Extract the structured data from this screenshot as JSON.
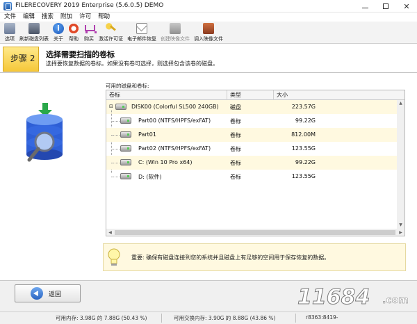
{
  "window": {
    "title": "FILERECOVERY 2019 Enterprise (5.6.0.5) DEMO",
    "minimize_glyph": "—",
    "maximize_glyph": "☐",
    "close_glyph": "✕"
  },
  "menu": [
    "文件",
    "编辑",
    "搜索",
    "附加",
    "许可",
    "帮助"
  ],
  "toolbar": [
    {
      "label": "选项",
      "icon": "options-icon",
      "enabled": true
    },
    {
      "label": "刷新磁盘列表",
      "icon": "refresh-disks-icon",
      "enabled": true
    },
    {
      "label": "关于",
      "icon": "about-icon",
      "enabled": true
    },
    {
      "label": "帮助",
      "icon": "help-lifebuoy-icon",
      "enabled": true
    },
    {
      "label": "购买",
      "icon": "shopping-cart-icon",
      "enabled": true
    },
    {
      "label": "激活许可证",
      "icon": "key-icon",
      "enabled": true
    },
    {
      "label": "电子邮件恢复",
      "icon": "envelope-icon",
      "enabled": true
    },
    {
      "label": "创建映像文件",
      "icon": "create-image-icon",
      "enabled": false
    },
    {
      "label": "调入映像文件",
      "icon": "load-image-icon",
      "enabled": true
    }
  ],
  "toolbar_about_glyph": "i",
  "step": {
    "badge": "步骤 2",
    "title": "选择需要扫描的卷标",
    "description": "选择要恢复数据的卷标。如果没有卷可选择，则选择包含该卷的磁盘。"
  },
  "volumes": {
    "caption": "可用的磁盘和卷标:",
    "columns": [
      "卷标",
      "类型",
      "大小"
    ],
    "expand_glyph": "⊟",
    "rows": [
      {
        "name": "DISK00 (Colorful SL500 240GB)",
        "type": "磁盘",
        "size": "223.57G"
      },
      {
        "name": "Part00 (NTFS/HPFS/exFAT)",
        "type": "卷标",
        "size": "99.22G"
      },
      {
        "name": "Part01",
        "type": "卷标",
        "size": "812.00M"
      },
      {
        "name": "Part02 (NTFS/HPFS/exFAT)",
        "type": "卷标",
        "size": "123.55G"
      },
      {
        "name": "C: (Win 10 Pro x64)",
        "type": "卷标",
        "size": "99.22G"
      },
      {
        "name": "D: (软件)",
        "type": "卷标",
        "size": "123.55G"
      }
    ],
    "scroll_up": "▲",
    "scroll_down": "▼",
    "scroll_left": "◀",
    "scroll_right": "▶"
  },
  "notice": {
    "text": "重要: 确保有磁盘连接到您的系统并且磁盘上有足够的空间用于保存恢复的数据。"
  },
  "footer": {
    "back_label": "返回"
  },
  "status": {
    "memory": "可用内存: 3.98G 的 7.88G (50.43 %)",
    "swap": "可用交换内存: 3.90G 的 8.88G (43.86 %)",
    "build": "r8363:8419-"
  },
  "watermark": {
    "main": "11684",
    "tld": ".com"
  },
  "colors": {
    "step_badge": "#f5c83a",
    "row_highlight": "#fff9e0",
    "notice_bg": "#fff9e0"
  }
}
